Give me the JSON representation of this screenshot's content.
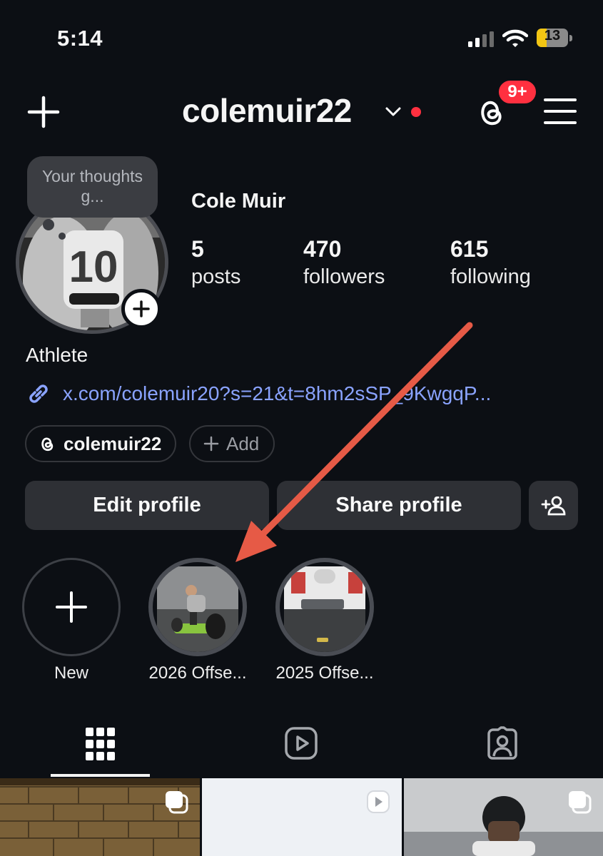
{
  "status_bar": {
    "time": "5:14",
    "battery": "13",
    "battery_level": 0.13
  },
  "header": {
    "username": "colemuir22",
    "notification_badge": "9+"
  },
  "profile": {
    "note": "Your thoughts g...",
    "display_name": "Cole Muir",
    "stats": [
      {
        "value": "5",
        "label": "posts"
      },
      {
        "value": "470",
        "label": "followers"
      },
      {
        "value": "615",
        "label": "following"
      }
    ],
    "bio": "Athlete",
    "link": "x.com/colemuir20?s=21&t=8hm2sSP_9KwgqP..."
  },
  "chips": {
    "threads_handle": "colemuir22",
    "add_label": "Add"
  },
  "actions": {
    "edit_label": "Edit profile",
    "share_label": "Share profile"
  },
  "highlights": [
    {
      "label": "New"
    },
    {
      "label": "2026 Offse..."
    },
    {
      "label": "2025 Offse..."
    }
  ],
  "tabs": [
    "posts-grid-icon",
    "reels-icon",
    "tagged-icon"
  ],
  "colors": {
    "accent_red": "#ff3040",
    "link_blue": "#8aa3ff",
    "arrow_annotation": "#e65a46",
    "background": "#0c0f14"
  }
}
